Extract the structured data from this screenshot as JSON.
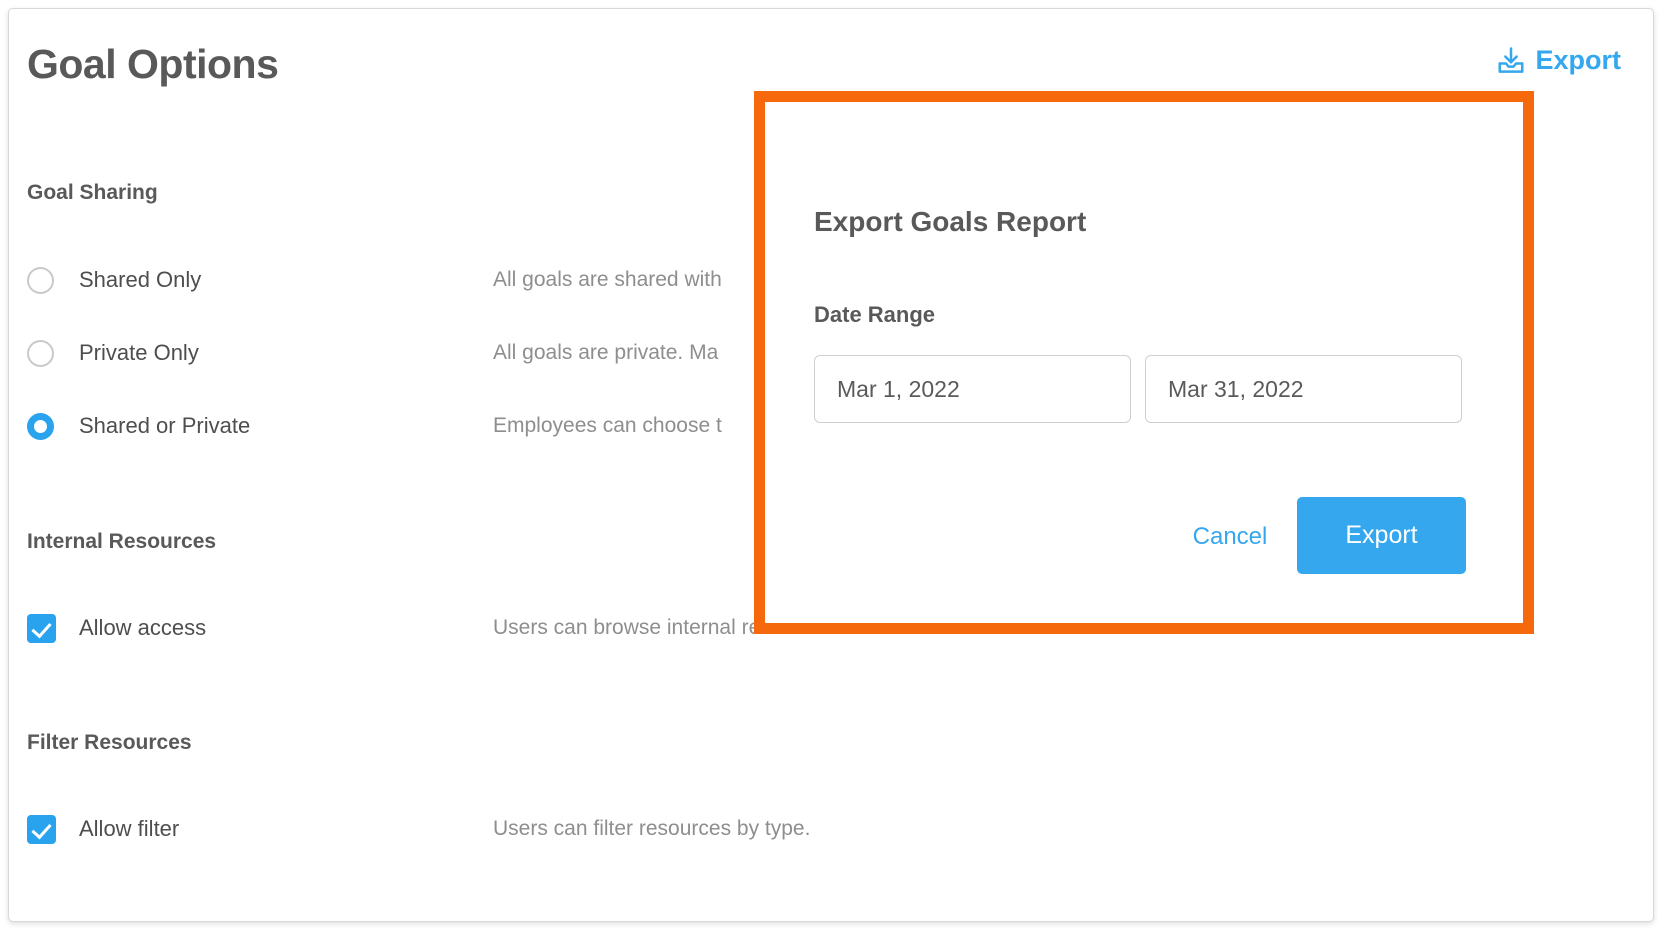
{
  "page": {
    "title": "Goal Options"
  },
  "header": {
    "export_link_label": "Export",
    "export_icon": "download-tray-icon"
  },
  "colors": {
    "accent_blue": "#35A7EE",
    "highlight_orange": "#F5680B",
    "heading_gray": "#595959",
    "description_gray": "#8e8e8e"
  },
  "sections": [
    {
      "heading": "Goal Sharing",
      "options": [
        {
          "label": "Shared Only",
          "control": "radio",
          "checked": false,
          "description": "All goals are shared with"
        },
        {
          "label": "Private Only",
          "control": "radio",
          "checked": false,
          "description": "All goals are private. Ma"
        },
        {
          "label": "Shared or Private",
          "control": "radio",
          "checked": true,
          "description": "Employees can choose t"
        }
      ]
    },
    {
      "heading": "Internal Resources",
      "options": [
        {
          "label": "Allow access",
          "control": "checkbox",
          "checked": true,
          "description": "Users can browse internal resources and add them to task activities."
        }
      ]
    },
    {
      "heading": "Filter Resources",
      "options": [
        {
          "label": "Allow filter",
          "control": "checkbox",
          "checked": true,
          "description": "Users can filter resources by type."
        }
      ]
    }
  ],
  "modal": {
    "title": "Export Goals Report",
    "date_range_label": "Date Range",
    "date_start_value": "Mar 1, 2022",
    "date_end_value": "Mar 31, 2022",
    "cancel_label": "Cancel",
    "export_label": "Export"
  }
}
